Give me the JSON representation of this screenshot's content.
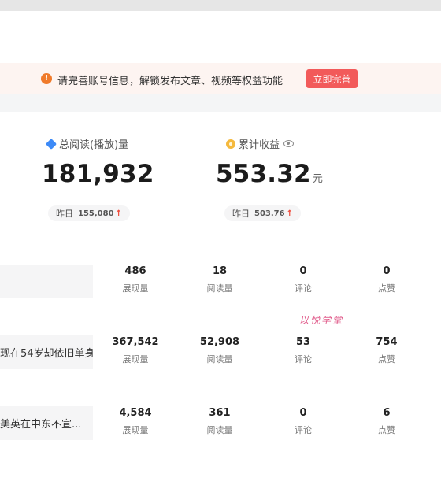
{
  "notice": {
    "icon": "alert-icon",
    "text": "请完善账号信息，解锁发布文章、视频等权益功能",
    "button_label": "立即完善"
  },
  "stats": [
    {
      "icon": "read-icon",
      "label": "总阅读(播放)量",
      "value": "181,932",
      "unit": "",
      "yesterday_label": "昨日",
      "yesterday_value": "155,080"
    },
    {
      "icon": "coin-icon",
      "label": "累计收益",
      "value": "553.32",
      "unit": "元",
      "yesterday_label": "昨日",
      "yesterday_value": "503.76"
    }
  ],
  "articles": [
    {
      "title": "",
      "metrics": [
        {
          "value": "486",
          "label": "展现量"
        },
        {
          "value": "18",
          "label": "阅读量"
        },
        {
          "value": "0",
          "label": "评论"
        },
        {
          "value": "0",
          "label": "点赞"
        }
      ]
    },
    {
      "title": "现在54岁却依旧单身",
      "metrics": [
        {
          "value": "367,542",
          "label": "展现量"
        },
        {
          "value": "52,908",
          "label": "阅读量"
        },
        {
          "value": "53",
          "label": "评论"
        },
        {
          "value": "754",
          "label": "点赞"
        }
      ]
    },
    {
      "title": "美英在中东不宣...",
      "metrics": [
        {
          "value": "4,584",
          "label": "展现量"
        },
        {
          "value": "361",
          "label": "阅读量"
        },
        {
          "value": "0",
          "label": "评论"
        },
        {
          "value": "6",
          "label": "点赞"
        }
      ]
    }
  ],
  "watermark": "以悦学堂",
  "colors": {
    "accent_red": "#f25a5a",
    "notice_bg": "#fdf4f1",
    "alert_orange": "#f07a2a",
    "read_blue": "#3d8af7",
    "coin_gold": "#f5b93d",
    "up_red": "#f04a3a"
  }
}
